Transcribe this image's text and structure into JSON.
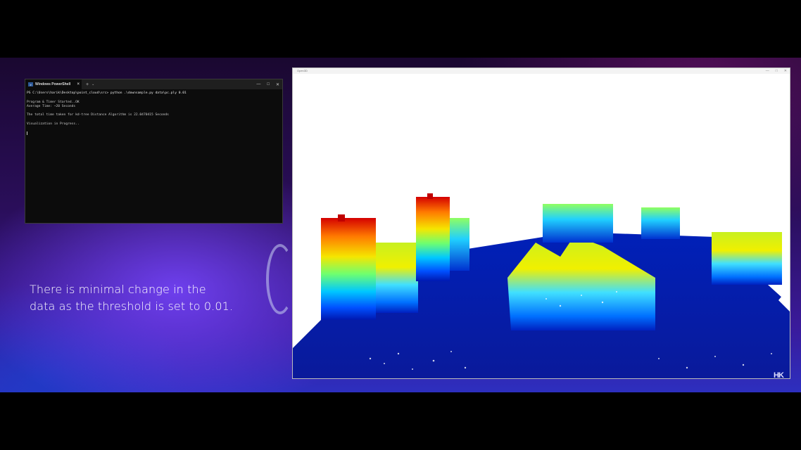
{
  "terminal": {
    "tab_title": "Windows PowerShell",
    "ps_icon": "powershell-icon",
    "close_tab": "×",
    "new_tab": "+",
    "dropdown": "⌄",
    "minimize": "—",
    "maximize": "□",
    "close": "✕",
    "lines": {
      "l1": "PS C:\\Users\\harik\\Desktop\\point_cloud\\src> python .\\downsample.py data\\pc.ply 0.01",
      "l2": "",
      "l3": "Program & Timer Started..OK",
      "l4": "Average Time: ~20 Seconds",
      "l5": "",
      "l6": "The total time taken for kd-tree Distance Algorithm is 22.0470415 Seconds",
      "l7": "",
      "l8": "Visualization in Progress.."
    }
  },
  "caption": {
    "line1": "There is minimal change in the",
    "line2": "data as the threshold is set to 0.01."
  },
  "viewer": {
    "title": "Open3D",
    "minimize": "—",
    "maximize": "□",
    "close": "✕"
  },
  "watermark": "HK"
}
